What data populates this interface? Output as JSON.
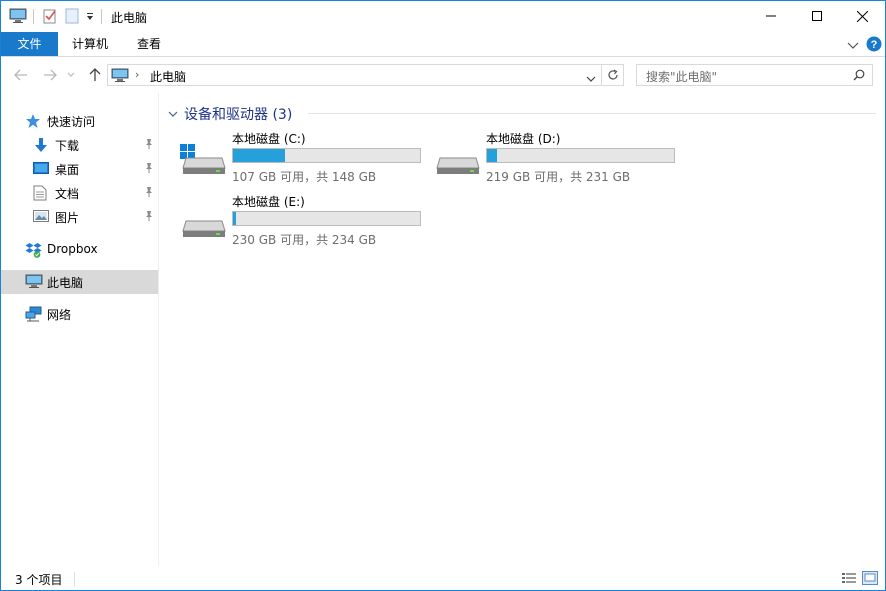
{
  "window": {
    "title": "此电脑"
  },
  "ribbon": {
    "tabs": [
      {
        "label": "文件"
      },
      {
        "label": "计算机"
      },
      {
        "label": "查看"
      }
    ]
  },
  "address": {
    "crumb": "此电脑"
  },
  "search": {
    "placeholder": "搜索\"此电脑\""
  },
  "sidebar": {
    "quick_access": "快速访问",
    "items": [
      {
        "label": "下载"
      },
      {
        "label": "桌面"
      },
      {
        "label": "文档"
      },
      {
        "label": "图片"
      }
    ],
    "dropbox": "Dropbox",
    "this_pc": "此电脑",
    "network": "网络"
  },
  "group": {
    "title": "设备和驱动器 (3)"
  },
  "drives": [
    {
      "name": "本地磁盘 (C:)",
      "info": "107 GB 可用，共 148 GB",
      "used_fraction": 0.277
    },
    {
      "name": "本地磁盘 (D:)",
      "info": "219 GB 可用，共 231 GB",
      "used_fraction": 0.052
    },
    {
      "name": "本地磁盘 (E:)",
      "info": "230 GB 可用，共 234 GB",
      "used_fraction": 0.017
    }
  ],
  "status": {
    "count": "3 个项目"
  },
  "colors": {
    "accent": "#1979ca",
    "bar_fill": "#26a0da",
    "group_header": "#1e3287"
  }
}
